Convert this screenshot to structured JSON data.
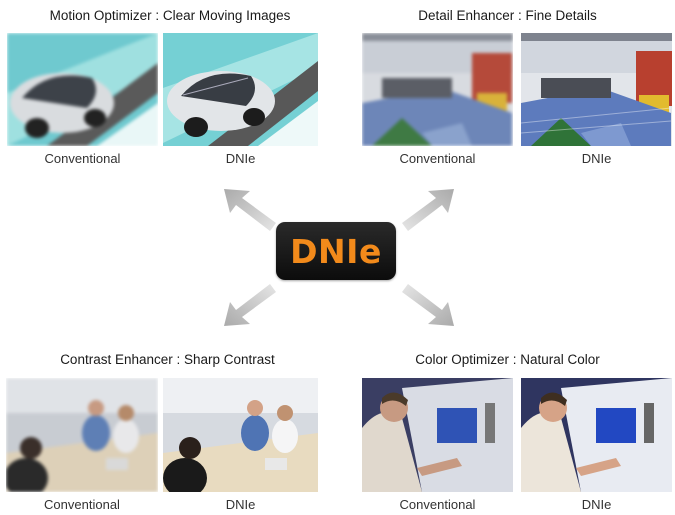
{
  "center_logo": "DNIe",
  "quadrants": [
    {
      "id": "motion",
      "title": "Motion Optimizer : Clear Moving Images",
      "left_caption": "Conventional",
      "right_caption": "DNIe"
    },
    {
      "id": "detail",
      "title": "Detail Enhancer : Fine Details",
      "left_caption": "Conventional",
      "right_caption": "DNIe"
    },
    {
      "id": "contrast",
      "title": "Contrast Enhancer : Sharp Contrast",
      "left_caption": "Conventional",
      "right_caption": "DNIe"
    },
    {
      "id": "color",
      "title": "Color Optimizer : Natural Color",
      "left_caption": "Conventional",
      "right_caption": "DNIe"
    }
  ],
  "colors": {
    "logo_text": "#f28a1b",
    "logo_bg": "#111111",
    "arrow": "#bfbfbf"
  }
}
